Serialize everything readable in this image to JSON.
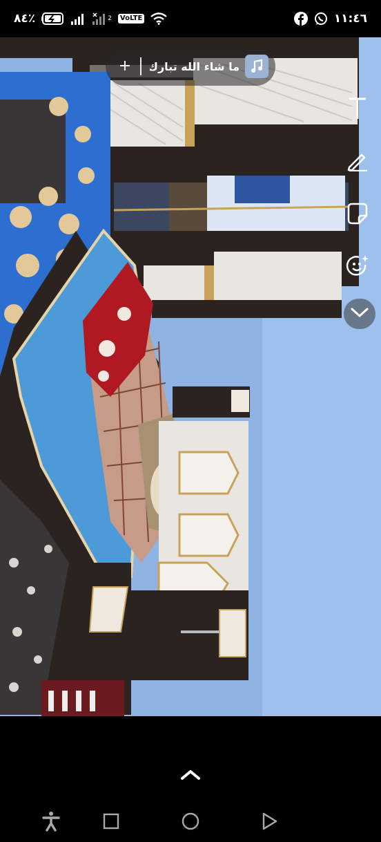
{
  "status_bar": {
    "time": "١١:٤٦",
    "battery": "٨٤٪",
    "network_badge": "VoLTE",
    "sim2_label": "2",
    "app_icons": [
      "facebook-icon",
      "whatsapp-icon"
    ]
  },
  "music_sticker": {
    "title": "ما شاء الله تبارك ...",
    "add_label": "+",
    "icon": "music-note-icon"
  },
  "tools": [
    {
      "name": "text-tool",
      "icon": "text-T-icon"
    },
    {
      "name": "draw-tool",
      "icon": "pencil-icon"
    },
    {
      "name": "sticker-tool",
      "icon": "sticker-icon"
    },
    {
      "name": "emoji-tool",
      "icon": "smiley-sparkle-icon"
    },
    {
      "name": "more-tools",
      "icon": "chevron-down-icon"
    }
  ],
  "swipe_up": {
    "icon": "chevron-up-icon"
  },
  "nav": [
    {
      "name": "accessibility",
      "icon": "accessibility-icon"
    },
    {
      "name": "recents",
      "icon": "square-icon"
    },
    {
      "name": "home",
      "icon": "circle-icon"
    },
    {
      "name": "back",
      "icon": "triangle-icon"
    }
  ],
  "colors": {
    "wall": "#8fb4e3",
    "wardrobe": "#2a2320",
    "panel": "#e9e6e2",
    "gold": "#c9a259",
    "bedspread": "#4d9ad8"
  }
}
